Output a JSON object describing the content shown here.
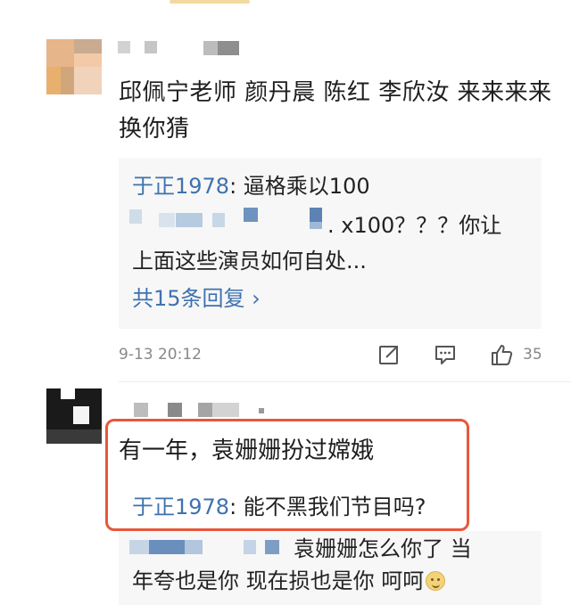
{
  "comments": [
    {
      "text": "邱佩宁老师 颜丹晨 陈红  李欣汝 来来来来换你猜",
      "replies": [
        {
          "user": "于正1978",
          "separator": ":",
          "content": " 逼格乘以100"
        },
        {
          "user": "",
          "separator": "",
          "content": ". x100？？？你让"
        },
        {
          "user": "",
          "separator": "",
          "content": "上面这些演员如何自处..."
        }
      ],
      "more_replies": "共15条回复 ›",
      "time": "9-13 20:12",
      "like_count": "35",
      "icons": [
        "share-icon",
        "comment-icon",
        "like-icon"
      ]
    },
    {
      "text": "有一年，袁姗姗扮过嫦娥",
      "replies": [
        {
          "user": "于正1978",
          "separator": ":",
          "content": " 能不黑我们节目吗?"
        },
        {
          "user": "",
          "separator": "",
          "content": "袁姗姗怎么你了  当"
        },
        {
          "user": "",
          "separator": "",
          "content": "年夸也是你 现在损也是你 呵呵"
        }
      ],
      "emoji": "smile-emoji-icon"
    }
  ],
  "colors": {
    "link": "#3f72af",
    "highlight_border": "#e8573a",
    "reply_bg": "#f7f7f7",
    "meta_text": "#888888"
  }
}
